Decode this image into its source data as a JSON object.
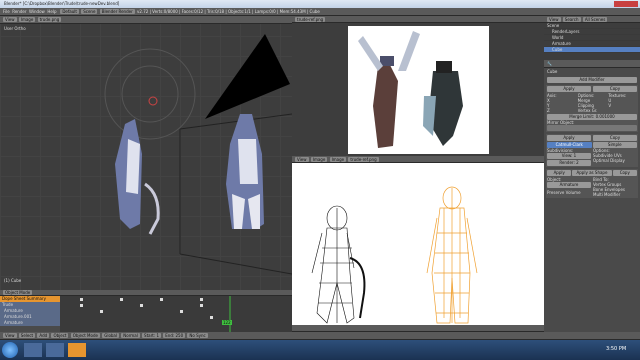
{
  "window": {
    "title": "Blender* [C:\\Dropbox\\Blender\\Trude\\trude-newDev.blend]"
  },
  "info_header": {
    "menus": [
      "File",
      "Render",
      "Window",
      "Help"
    ],
    "layout": "Default",
    "scene": "Scene",
    "engine": "Blender Render",
    "stats": "v2.72 | Verts:0/8000 | Faces:0/12 | Tris:0/18 | Objects:1/1 | Lamps:0/0 | Mem:54.43M | Cube"
  },
  "viewport": {
    "label": "User Ortho",
    "object_label": "(1) Cube",
    "header_items": [
      "View",
      "Image",
      "trude.png"
    ]
  },
  "image_editor_top": {
    "filename": "trude-ref.png"
  },
  "image_editor_bottom": {
    "items": [
      "View",
      "Image",
      "Image",
      "trude-ref.png"
    ]
  },
  "timeline": {
    "mode": "Object Mode",
    "rows": [
      "Dope Sheet Summary",
      "Trude",
      "Armature",
      "Armature.001",
      "Armature"
    ],
    "current_frame": "122",
    "start": "Start: 1",
    "end": "End: 250",
    "bottom_items": [
      "View",
      "Select",
      "Add",
      "Object",
      "Object Mode",
      "Global",
      "Normal"
    ],
    "sync": "No Sync"
  },
  "outliner": {
    "header": [
      "View",
      "Search",
      "All Scenes"
    ],
    "items": [
      "Scene",
      "RenderLayers",
      "World",
      "Armature",
      "Cube"
    ]
  },
  "properties": {
    "object_name": "Cube",
    "add_modifier": "Add Modifier",
    "mirror": {
      "buttons": [
        "Apply",
        "Copy"
      ],
      "axis_label": "Axis:",
      "options_label": "Options:",
      "texture_label": "Textures:",
      "axes": [
        "X",
        "Y",
        "Z"
      ],
      "options": [
        "Merge",
        "Clipping",
        "Vertex Gr."
      ],
      "texture_opts": [
        "U",
        "V"
      ],
      "merge_limit": "Merge Limit: 0.001000",
      "mirror_object": "Mirror Object:"
    },
    "subsurf": {
      "buttons": [
        "Apply",
        "Copy"
      ],
      "mode_left": "Catmull-Clark",
      "mode_right": "Simple",
      "subdivisions_label": "Subdivisions:",
      "view": "View: 1",
      "render": "Render: 2",
      "options_label": "Options:",
      "opt1": "Subdivide UVs",
      "opt2": "Optimal Display"
    },
    "armature": {
      "buttons": [
        "Apply",
        "Apply as Shape",
        "Copy"
      ],
      "object_label": "Object:",
      "object_value": "Armature",
      "bind_label": "Bind To:",
      "opts": [
        "Vertex Groups",
        "Bone Envelopes"
      ],
      "preserve": "Preserve Volume",
      "multi": "Multi Modifier"
    }
  },
  "taskbar": {
    "time": "3:50 PM"
  },
  "colors": {
    "accent": "#e6952f",
    "blue": "#5680c2",
    "orange_mesh": "#f0a030"
  }
}
